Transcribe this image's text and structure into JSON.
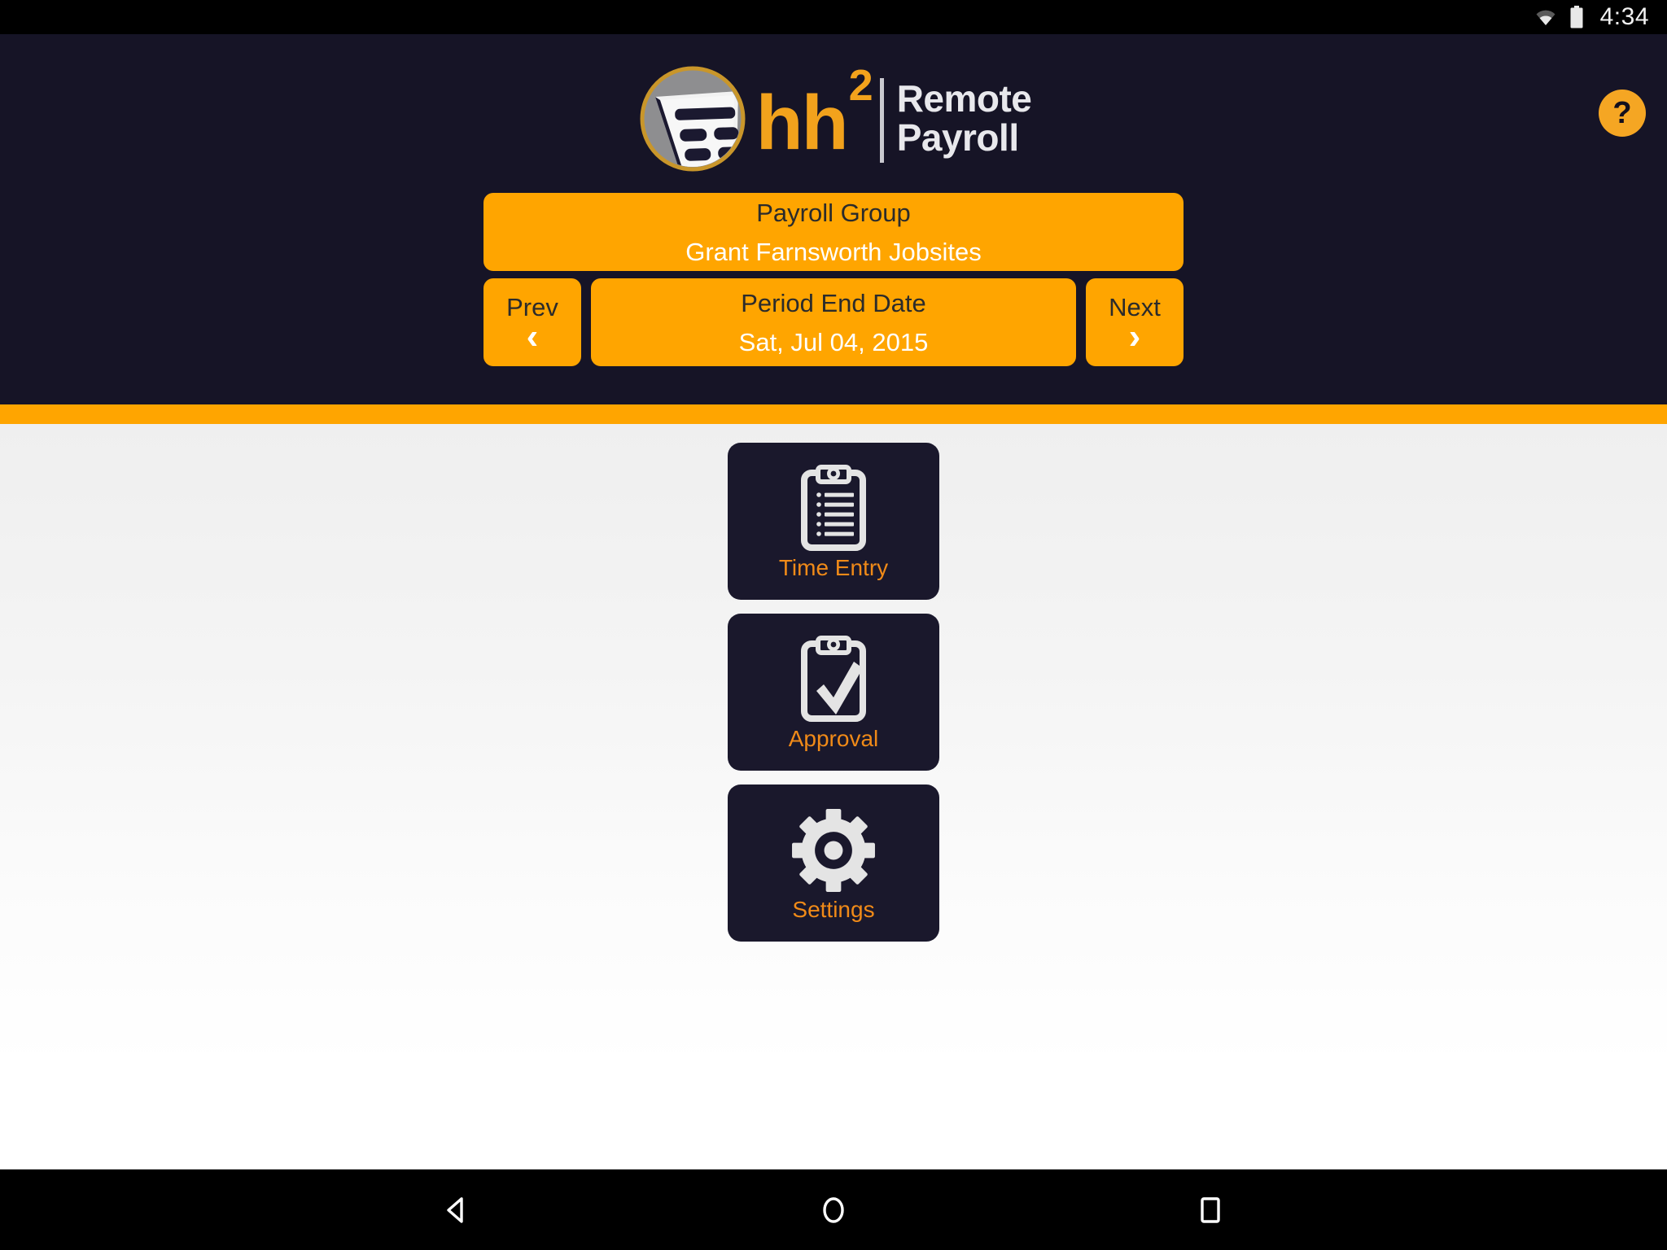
{
  "statusbar": {
    "time": "4:34",
    "wifi_icon": "wifi-icon",
    "battery_icon": "battery-icon"
  },
  "header": {
    "background_color": "#161426",
    "accent_color": "#FFA500",
    "logo": {
      "mark_icon": "hh2-logo-mark-icon",
      "brand": "hh",
      "superscript": "2",
      "product_line1": "Remote",
      "product_line2": "Payroll"
    },
    "help_button": {
      "label": "?",
      "icon": "question-mark-icon"
    },
    "payroll_group": {
      "label": "Payroll Group",
      "value": "Grant Farnsworth Jobsites"
    },
    "prev_button": {
      "label": "Prev",
      "icon": "chevron-left-icon",
      "glyph": "‹"
    },
    "period": {
      "label": "Period End Date",
      "value": "Sat, Jul 04, 2015"
    },
    "next_button": {
      "label": "Next",
      "icon": "chevron-right-icon",
      "glyph": "›"
    }
  },
  "main": {
    "background_top_color": "#efefef",
    "background_bottom_color": "#ffffff",
    "tile_color": "#1a182c",
    "tile_label_color": "#f08a18",
    "tiles": [
      {
        "label": "Time Entry",
        "icon": "clipboard-list-icon"
      },
      {
        "label": "Approval",
        "icon": "clipboard-check-icon"
      },
      {
        "label": "Settings",
        "icon": "gear-icon"
      }
    ]
  },
  "navbar": {
    "back": "back-icon",
    "home": "home-icon",
    "recents": "recents-icon"
  }
}
